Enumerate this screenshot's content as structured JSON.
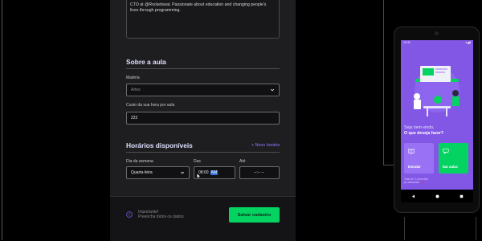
{
  "form": {
    "bio_text": "CTO at @Rocketseat. Passionate about education and changing people's lives through programming.",
    "section_class": {
      "title": "Sobre a aula",
      "subject_label": "Matéria",
      "subject_value": "Artes",
      "cost_label": "Custo da sua hora por aula",
      "cost_value": "222"
    },
    "section_schedule": {
      "title": "Horários disponíveis",
      "new_schedule_link": "+ Novo horário",
      "weekday_label": "Dia da semana",
      "weekday_value": "Quarta-feira",
      "from_label": "Das",
      "from_hour": "08:00",
      "from_ampm": "AM",
      "to_label": "Até",
      "to_value": "--:-- --"
    },
    "footer": {
      "important": "Importante!",
      "note": "Preencha todos os dados",
      "save_button": "Salvar cadastro"
    }
  },
  "phone": {
    "status_time": "12:41",
    "greeting_line1": "Seja bem-vindo,",
    "greeting_line2": "O que deseja fazer?",
    "study_button": "Estudar",
    "teach_button": "Dar aulas",
    "connections_line1": "Total de 2 conexões",
    "connections_line2": "já realizadas 💜"
  },
  "colors": {
    "purple": "#8257e5",
    "purple_light": "#9871f5",
    "green": "#04d361",
    "accent_text": "#8f7cff"
  },
  "icons": [
    "chevron-down-icon",
    "warning-icon",
    "clock-icon",
    "book-icon",
    "chat-icon",
    "back-icon",
    "home-icon",
    "recents-icon"
  ]
}
